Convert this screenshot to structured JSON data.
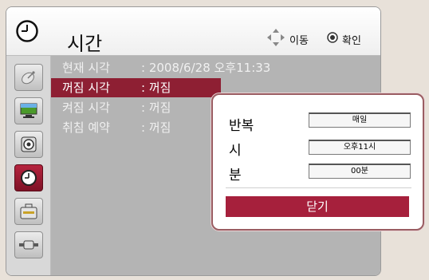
{
  "header": {
    "title": "시간",
    "move_label": "이동",
    "ok_label": "확인"
  },
  "sidebar": {
    "items": [
      {
        "icon": "satellite-dish-icon"
      },
      {
        "icon": "monitor-icon"
      },
      {
        "icon": "speaker-icon"
      },
      {
        "icon": "clock-icon",
        "active": true
      },
      {
        "icon": "toolbox-icon"
      },
      {
        "icon": "input-plug-icon"
      }
    ]
  },
  "menu": {
    "rows": [
      {
        "label": "현재 시각",
        "value": ": 2008/6/28 오후11:33"
      },
      {
        "label": "꺼짐 시각",
        "value": ": 꺼짐",
        "selected": true
      },
      {
        "label": "켜짐 시각",
        "value": ": 꺼짐"
      },
      {
        "label": "취침 예약",
        "value": ": 꺼짐"
      }
    ]
  },
  "popup": {
    "repeat_label": "반복",
    "repeat_value": "매일",
    "hour_label": "시",
    "hour_value": "오후11시",
    "minute_label": "분",
    "minute_value": "00분",
    "close_label": "닫기"
  },
  "colors": {
    "accent": "#8e1f33",
    "button": "#a6203c",
    "panel_bg": "#b4b4b4"
  }
}
